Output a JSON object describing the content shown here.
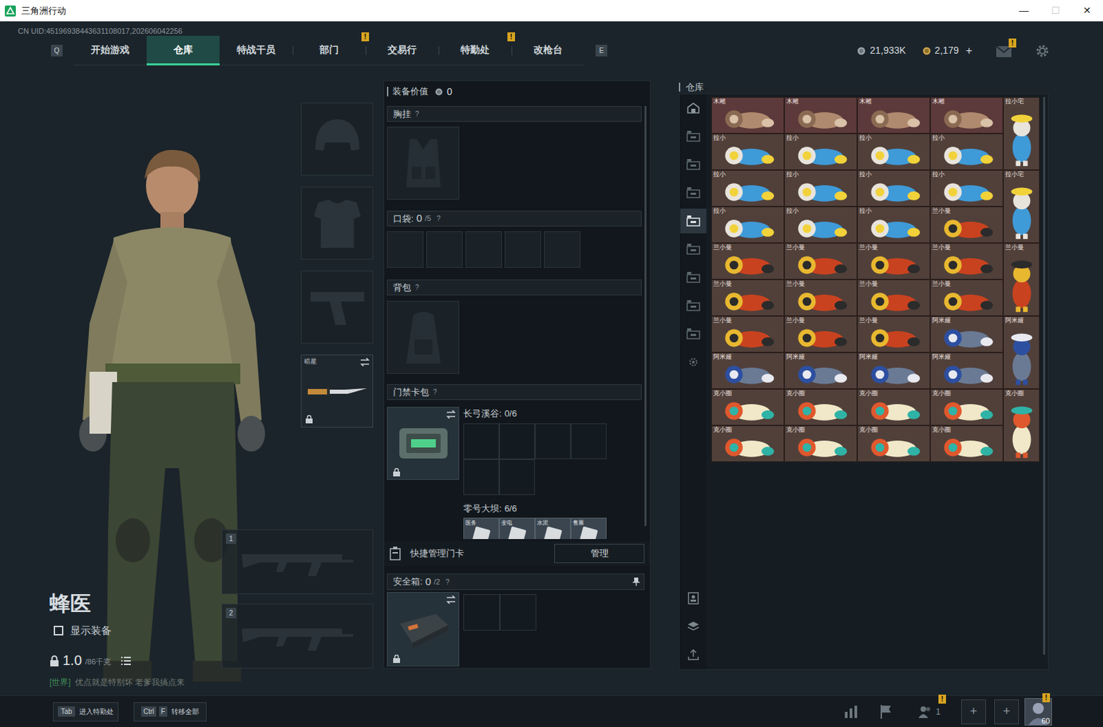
{
  "window": {
    "title": "三角洲行动",
    "controls": [
      {
        "label": "—",
        "disabled": false
      },
      {
        "label": "☐",
        "disabled": true
      },
      {
        "label": "✕",
        "disabled": false
      }
    ]
  },
  "uid": "CN UID:45196938443631108017,202606042256",
  "nav": {
    "prev_key": "Q",
    "next_key": "E",
    "tabs": [
      {
        "label": "开始游戏",
        "selected": false,
        "badge": null
      },
      {
        "label": "仓库",
        "selected": true,
        "badge": null
      },
      {
        "label": "特战干员",
        "selected": false,
        "badge": null
      },
      {
        "label": "部门",
        "selected": false,
        "badge": "!"
      },
      {
        "label": "交易行",
        "selected": false,
        "badge": null
      },
      {
        "label": "特勤处",
        "selected": false,
        "badge": "!"
      },
      {
        "label": "改枪台",
        "selected": false,
        "badge": null
      }
    ]
  },
  "currency": {
    "coins": "21,933K",
    "tickets": "2,179",
    "add": "+"
  },
  "mail": {
    "badge": "!"
  },
  "operator": {
    "name": "蜂医",
    "show_equipment": {
      "label": "显示装备",
      "checked": false
    },
    "weight": "1.0",
    "weight_max": "/86千克"
  },
  "chat": {
    "channel": "[世界]",
    "text": "优点就是特别坏  老爹我搞点来"
  },
  "gear_slots": [
    {
      "kind": "helmet",
      "label": null,
      "locked": false
    },
    {
      "kind": "armor",
      "label": null,
      "locked": false
    },
    {
      "kind": "pistol",
      "label": null,
      "locked": false
    },
    {
      "kind": "melee",
      "label": "暗星",
      "locked": true
    }
  ],
  "weapon_slots": [
    {
      "number": "1"
    },
    {
      "number": "2"
    }
  ],
  "loadout": {
    "value_label": "装备价值",
    "value": "0",
    "help": "?",
    "chest": {
      "label": "胸挂"
    },
    "pockets": {
      "label": "口袋:",
      "count": "0",
      "capacity": "/5",
      "slots": 5
    },
    "backpack": {
      "label": "背包"
    },
    "keycards": {
      "label": "门禁卡包",
      "locked": true,
      "maps": [
        {
          "name": "长弓溪谷:",
          "count": "0/6",
          "slots": 6,
          "cards": []
        },
        {
          "name": "零号大坝:",
          "count": "6/6",
          "slots": 6,
          "cards": [
            "医务",
            "变电",
            "水泥",
            "售票"
          ]
        }
      ]
    },
    "quick_manage": {
      "label": "快捷管理门卡",
      "button": "管理"
    },
    "safebox": {
      "label": "安全箱:",
      "count": "0",
      "capacity": "/2",
      "slots": 2,
      "locked": true
    }
  },
  "warehouse": {
    "title": "仓库",
    "sidebar": [
      {
        "selected": false
      },
      {
        "selected": false
      },
      {
        "selected": false
      },
      {
        "selected": false
      },
      {
        "selected": true
      },
      {
        "selected": false
      },
      {
        "selected": false
      },
      {
        "selected": false
      },
      {
        "selected": false
      }
    ],
    "items": [
      {
        "name": "木雕",
        "kind": "carving",
        "tall": false,
        "color": "#5c393a"
      },
      {
        "name": "木雕",
        "kind": "carving",
        "tall": false,
        "color": "#5c393a"
      },
      {
        "name": "木雕",
        "kind": "carving",
        "tall": false,
        "color": "#5c393a"
      },
      {
        "name": "木雕",
        "kind": "carving",
        "tall": false,
        "color": "#5c393a"
      },
      {
        "name": "拉小宅",
        "kind": "owl",
        "tall": true,
        "color": "#51403a"
      },
      {
        "name": "拉小",
        "kind": "owl",
        "tall": false,
        "color": "#51403a"
      },
      {
        "name": "拉小",
        "kind": "owl",
        "tall": false,
        "color": "#51403a"
      },
      {
        "name": "拉小",
        "kind": "owl",
        "tall": false,
        "color": "#51403a"
      },
      {
        "name": "拉小",
        "kind": "owl",
        "tall": false,
        "color": "#51403a"
      },
      {
        "name": "拉小",
        "kind": "owl",
        "tall": false,
        "color": "#51403a"
      },
      {
        "name": "拉小",
        "kind": "owl",
        "tall": false,
        "color": "#51403a"
      },
      {
        "name": "拉小",
        "kind": "owl",
        "tall": false,
        "color": "#51403a"
      },
      {
        "name": "拉小",
        "kind": "owl",
        "tall": false,
        "color": "#51403a"
      },
      {
        "name": "拉小宅",
        "kind": "owl",
        "tall": true,
        "color": "#51403a"
      },
      {
        "name": "拉小",
        "kind": "owl",
        "tall": false,
        "color": "#51403a"
      },
      {
        "name": "拉小",
        "kind": "owl",
        "tall": false,
        "color": "#51403a"
      },
      {
        "name": "拉小",
        "kind": "owl",
        "tall": false,
        "color": "#51403a"
      },
      {
        "name": "兰小曼",
        "kind": "mariachi",
        "tall": false,
        "color": "#51403a"
      },
      {
        "name": "兰小曼",
        "kind": "mariachi",
        "tall": false,
        "color": "#51403a"
      },
      {
        "name": "兰小曼",
        "kind": "mariachi",
        "tall": false,
        "color": "#51403a"
      },
      {
        "name": "兰小曼",
        "kind": "mariachi",
        "tall": false,
        "color": "#51403a"
      },
      {
        "name": "兰小曼",
        "kind": "mariachi",
        "tall": false,
        "color": "#51403a"
      },
      {
        "name": "兰小曼",
        "kind": "mariachi",
        "tall": true,
        "color": "#51403a"
      },
      {
        "name": "兰小曼",
        "kind": "mariachi",
        "tall": false,
        "color": "#51403a"
      },
      {
        "name": "兰小曼",
        "kind": "mariachi",
        "tall": false,
        "color": "#51403a"
      },
      {
        "name": "兰小曼",
        "kind": "mariachi",
        "tall": false,
        "color": "#51403a"
      },
      {
        "name": "兰小曼",
        "kind": "mariachi",
        "tall": false,
        "color": "#51403a"
      },
      {
        "name": "兰小曼",
        "kind": "mariachi",
        "tall": false,
        "color": "#51403a"
      },
      {
        "name": "兰小曼",
        "kind": "mariachi",
        "tall": false,
        "color": "#51403a"
      },
      {
        "name": "兰小曼",
        "kind": "mariachi",
        "tall": false,
        "color": "#51403a"
      },
      {
        "name": "阿米娅",
        "kind": "bunny",
        "tall": false,
        "color": "#51403a"
      },
      {
        "name": "阿米娅",
        "kind": "bunny",
        "tall": true,
        "color": "#51403a"
      },
      {
        "name": "阿米娅",
        "kind": "bunny",
        "tall": false,
        "color": "#51403a"
      },
      {
        "name": "阿米娅",
        "kind": "bunny",
        "tall": false,
        "color": "#51403a"
      },
      {
        "name": "阿米娅",
        "kind": "bunny",
        "tall": false,
        "color": "#51403a"
      },
      {
        "name": "阿米娅",
        "kind": "bunny",
        "tall": false,
        "color": "#51403a"
      },
      {
        "name": "克小圈",
        "kind": "explorer",
        "tall": false,
        "color": "#51403a"
      },
      {
        "name": "克小圈",
        "kind": "explorer",
        "tall": false,
        "color": "#51403a"
      },
      {
        "name": "克小圈",
        "kind": "explorer",
        "tall": false,
        "color": "#51403a"
      },
      {
        "name": "克小圈",
        "kind": "explorer",
        "tall": false,
        "color": "#51403a"
      },
      {
        "name": "克小圈",
        "kind": "explorer",
        "tall": true,
        "color": "#51403a"
      },
      {
        "name": "克小圈",
        "kind": "explorer",
        "tall": false,
        "color": "#51403a"
      },
      {
        "name": "克小圈",
        "kind": "explorer",
        "tall": false,
        "color": "#51403a"
      },
      {
        "name": "克小圈",
        "kind": "explorer",
        "tall": false,
        "color": "#51403a"
      },
      {
        "name": "克小圈",
        "kind": "explorer",
        "tall": false,
        "color": "#51403a"
      }
    ]
  },
  "bottom": {
    "tab_key": "Tab",
    "tab_label": "进入特勤处",
    "transfer_keys": [
      "Ctrl",
      "F"
    ],
    "transfer_label": "转移全部",
    "friends": "1",
    "friends_badge": "!",
    "add_slots": [
      "+",
      "+"
    ],
    "level": "60",
    "avatar_badge": "!"
  }
}
